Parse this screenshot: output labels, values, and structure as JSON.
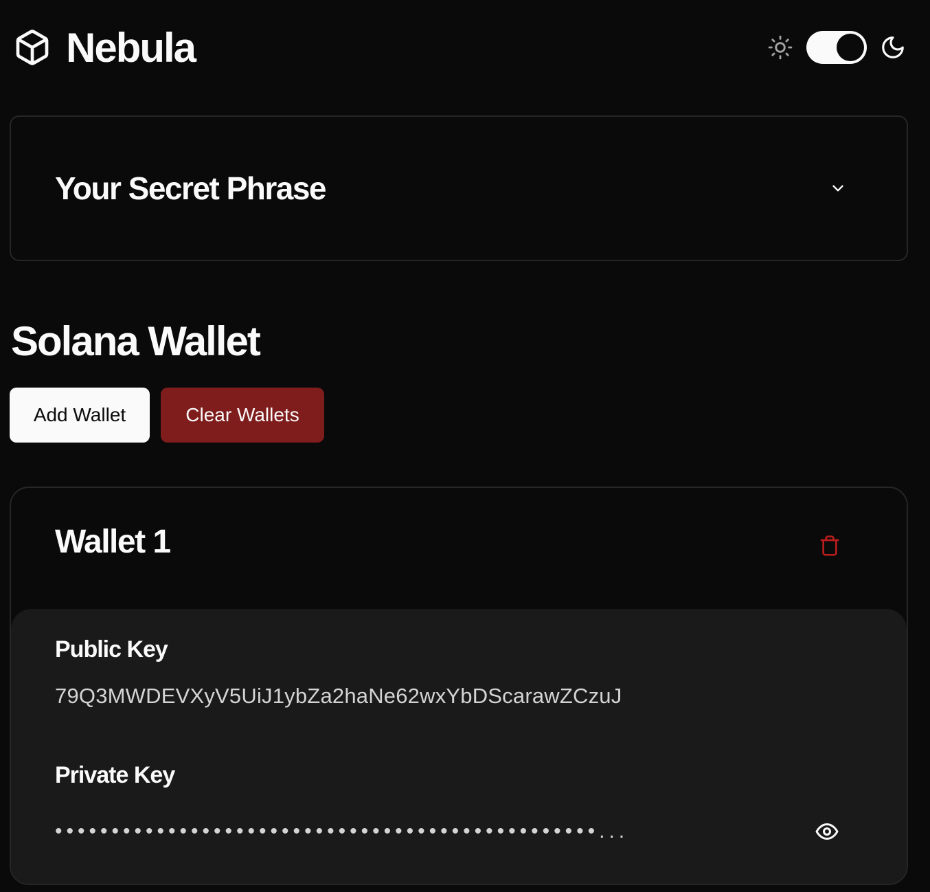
{
  "header": {
    "brand_name": "Nebula",
    "logo_icon": "cube-icon",
    "theme": {
      "sun_icon": "sun-icon",
      "moon_icon": "moon-icon",
      "dark_mode": true
    }
  },
  "secret_phrase": {
    "title": "Your Secret Phrase",
    "icon": "chevron-down-icon",
    "expanded": false
  },
  "wallet_section": {
    "title": "Solana Wallet",
    "add_label": "Add Wallet",
    "clear_label": "Clear Wallets"
  },
  "wallets": [
    {
      "title": "Wallet 1",
      "public_key_label": "Public Key",
      "public_key": "79Q3MWDEVXyV5UiJ1ybZa2haNe62wxYbDScarawZCzuJ",
      "private_key_label": "Private Key",
      "private_key_masked": "••••••••••••••••••••••••••••••••••••••••••••••••...",
      "private_visible": false
    }
  ],
  "colors": {
    "background": "#0a0a0a",
    "panel": "#1a1a1a",
    "border": "#262626",
    "danger": "#7f1d1d",
    "danger_icon": "#b91c1c",
    "text": "#fafafa"
  }
}
